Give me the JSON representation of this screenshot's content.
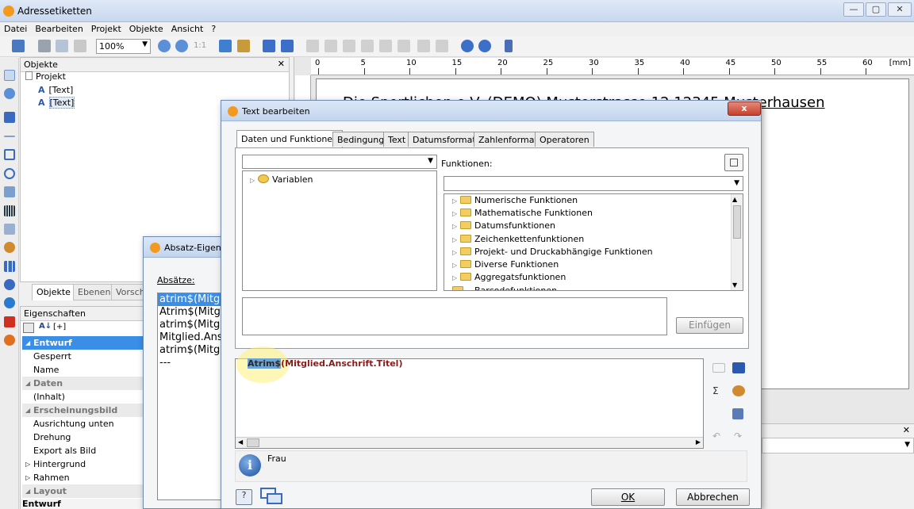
{
  "window": {
    "title": "Adressetiketten",
    "controls": [
      "—",
      "▢",
      "✕"
    ]
  },
  "menu": [
    "Datei",
    "Bearbeiten",
    "Projekt",
    "Objekte",
    "Ansicht",
    "?"
  ],
  "toolbar": {
    "zoom": "100%",
    "one_to_one": "1:1"
  },
  "objects_panel": {
    "title": "Objekte",
    "close": "✕",
    "tree": {
      "root": "Projekt",
      "items": [
        "[Text]",
        "[Text]"
      ]
    },
    "tabs": [
      "Objekte",
      "Ebenen",
      "Vorscha"
    ]
  },
  "properties": {
    "title": "Eigenschaften",
    "sort_label": "[+]",
    "rows": [
      {
        "label": "Entwurf",
        "kind": "cat-selected"
      },
      {
        "label": "Gesperrt",
        "kind": "item"
      },
      {
        "label": "Name",
        "kind": "item"
      },
      {
        "label": "Daten",
        "kind": "cat"
      },
      {
        "label": "(Inhalt)",
        "kind": "item"
      },
      {
        "label": "Erscheinungsbild",
        "kind": "cat"
      },
      {
        "label": "Ausrichtung unten",
        "kind": "item"
      },
      {
        "label": "Drehung",
        "kind": "item"
      },
      {
        "label": "Export als Bild",
        "kind": "item"
      },
      {
        "label": "Hintergrund",
        "kind": "subcat"
      },
      {
        "label": "Rahmen",
        "kind": "subcat"
      },
      {
        "label": "Layout",
        "kind": "cat"
      }
    ],
    "footer": "Entwurf"
  },
  "ruler": {
    "unit": "[mm]",
    "ticks": [
      "0",
      "5",
      "10",
      "15",
      "20",
      "25",
      "30",
      "35",
      "40",
      "45",
      "50",
      "55",
      "60"
    ]
  },
  "canvas": {
    "text": "Die Sportlichen e.V. (DEMO) Musterstrasse 12 12345 Musterhausen"
  },
  "absatz_dialog": {
    "title": "Absatz-Eigensc",
    "label": "Absätze:",
    "items": [
      "atrim$(Mitgli",
      "Atrim$(Mitgli",
      "atrim$(Mitgli",
      "Mitglied.Ansc",
      "atrim$(Mitgli",
      "---"
    ]
  },
  "text_dialog": {
    "title": "Text bearbeiten",
    "close": "x",
    "tabs": [
      "Daten und Funktionen",
      "Bedingung",
      "Text",
      "Datumsformat",
      "Zahlenformat",
      "Operatoren"
    ],
    "variables_tree": [
      "Variablen"
    ],
    "functions_label": "Funktionen:",
    "functions": [
      "Numerische Funktionen",
      "Mathematische Funktionen",
      "Datumsfunktionen",
      "Zeichenkettenfunktionen",
      "Projekt- und Druckabhängige Funktionen",
      "Diverse Funktionen",
      "Aggregatsfunktionen",
      "Barcodefunktionen"
    ],
    "insert_button": "Einfügen",
    "formula": {
      "selected_part": "Atrim$",
      "rest": "(Mitglied.Anschrift.Titel)"
    },
    "info_text": "Frau",
    "ok_button": "OK",
    "cancel_button": "Abbrechen"
  }
}
